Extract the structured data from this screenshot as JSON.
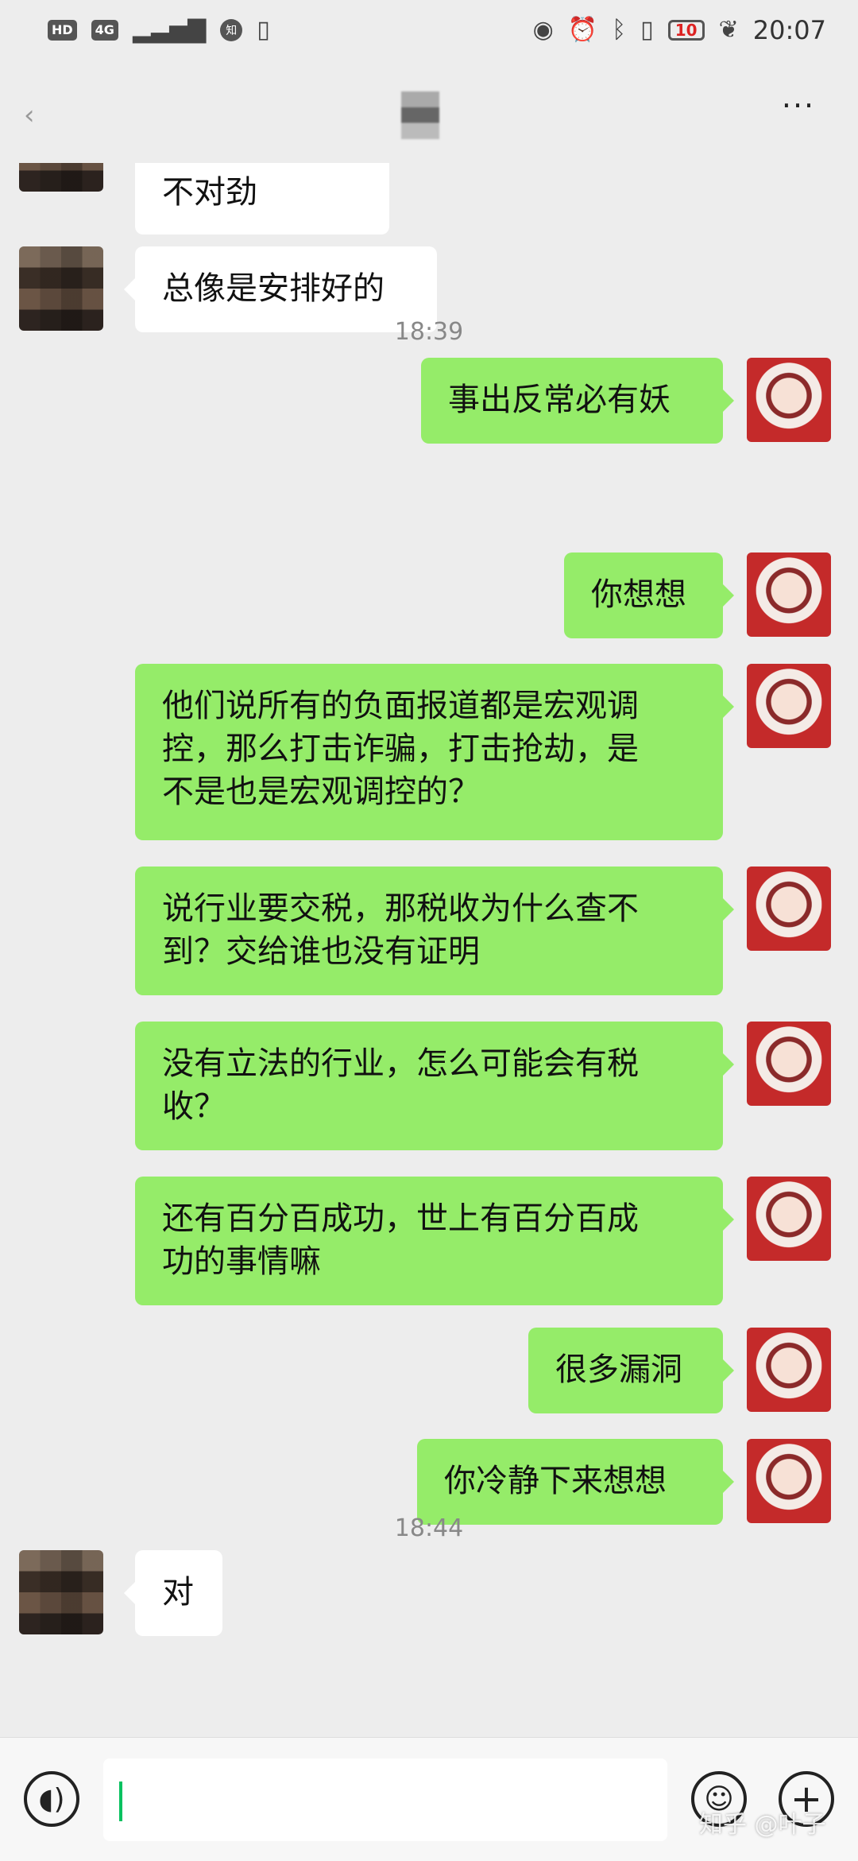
{
  "status_bar": {
    "hd": "HD",
    "network": "4G",
    "app_badge": "知",
    "battery": "10",
    "time": "20:07"
  },
  "title_bar": {
    "more": "···"
  },
  "messages": [
    {
      "side": "left",
      "text": "我总感觉事情不对劲"
    },
    {
      "side": "left",
      "text": "总像是安排好的"
    },
    {
      "side": "right",
      "text": "事出反常必有妖"
    },
    {
      "type": "time",
      "text": "18:39"
    },
    {
      "side": "right",
      "text": "你想想"
    },
    {
      "side": "right",
      "text": "他们说所有的负面报道都是宏观调\n控，那么打击诈骗，打击抢劫，是\n不是也是宏观调控的？"
    },
    {
      "side": "right",
      "text": "说行业要交税，那税收为什么查不\n到？交给谁也没有证明"
    },
    {
      "side": "right",
      "text": "没有立法的行业，怎么可能会有税\n收？"
    },
    {
      "side": "right",
      "text": "还有百分百成功，世上有百分百成\n功的事情嘛"
    },
    {
      "side": "right",
      "text": "很多漏洞"
    },
    {
      "side": "right",
      "text": "你冷静下来想想"
    },
    {
      "side": "left",
      "text": "对"
    },
    {
      "type": "time",
      "text": "18:44"
    }
  ],
  "input_bar": {
    "voice_icon": "voice-icon",
    "emoji_icon": "emoji-icon",
    "plus_icon": "plus-icon",
    "input_value": ""
  },
  "watermark": "知乎 @叶子"
}
